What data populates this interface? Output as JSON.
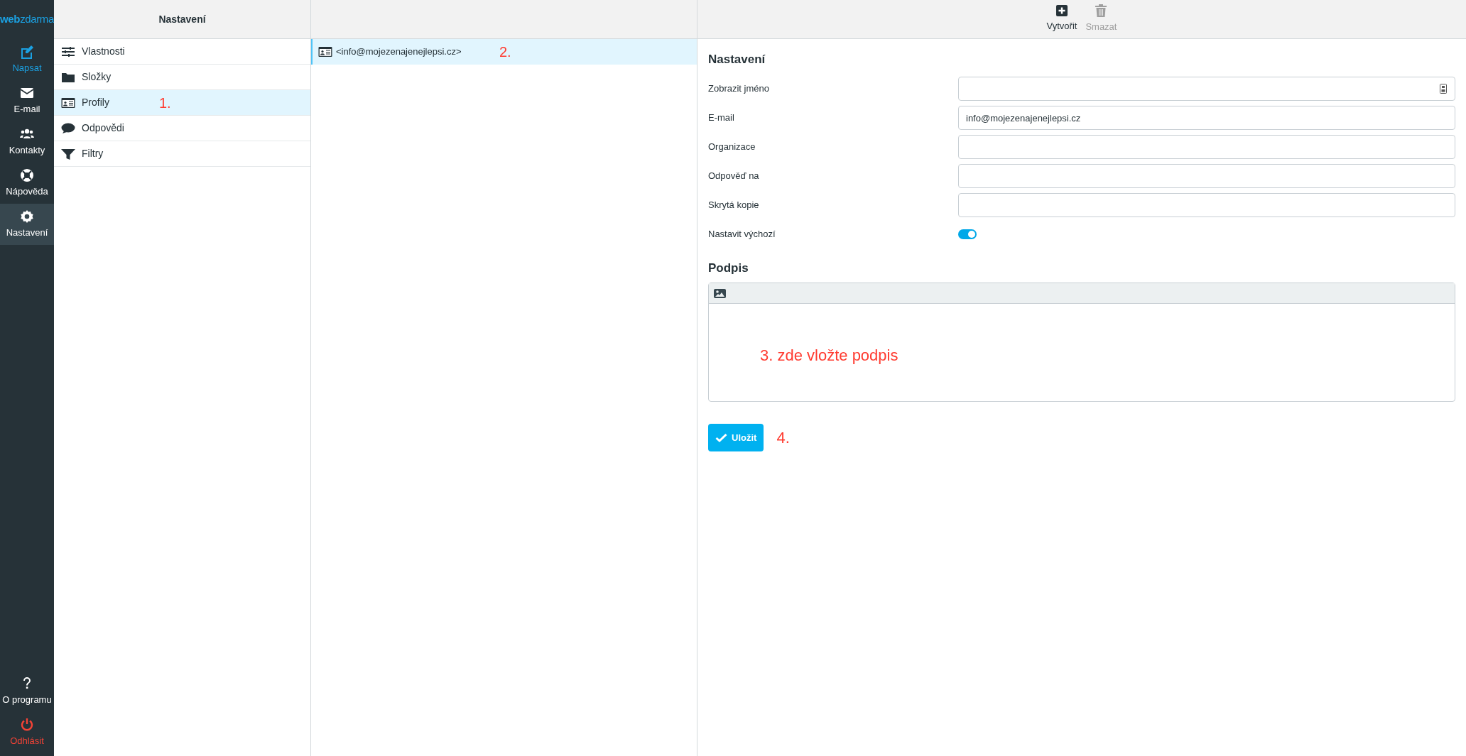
{
  "logo": {
    "part_1": "web",
    "part_2": "zdarma"
  },
  "nav": [
    {
      "kind": "compose",
      "label": "Napsat",
      "selected": false,
      "accent": true
    },
    {
      "kind": "mail",
      "label": "E-mail",
      "selected": false,
      "accent": false
    },
    {
      "kind": "contacts",
      "label": "Kontakty",
      "selected": false,
      "accent": false
    },
    {
      "kind": "help",
      "label": "Nápověda",
      "selected": false,
      "accent": false
    },
    {
      "kind": "settings",
      "label": "Nastavení",
      "selected": true,
      "accent": false
    }
  ],
  "nav_bottom": [
    {
      "kind": "about",
      "label": "O programu",
      "danger": false
    },
    {
      "kind": "logout",
      "label": "Odhlásit",
      "danger": true
    }
  ],
  "settings_panel": {
    "title": "Nastavení",
    "items": [
      {
        "kind": "sliders",
        "label": "Vlastnosti",
        "selected": false
      },
      {
        "kind": "folder",
        "label": "Složky",
        "selected": false
      },
      {
        "kind": "card",
        "label": "Profily",
        "selected": true,
        "note": "1."
      },
      {
        "kind": "speech",
        "label": "Odpovědi",
        "selected": false
      },
      {
        "kind": "filter",
        "label": "Filtry",
        "selected": false
      }
    ]
  },
  "identities": [
    {
      "label": "<info@mojezenajenejlepsi.cz>",
      "selected": true,
      "note": "2."
    }
  ],
  "toolbar": [
    {
      "kind": "create",
      "label": "Vytvořit",
      "disabled": false
    },
    {
      "kind": "delete",
      "label": "Smazat",
      "disabled": true
    }
  ],
  "form": {
    "section": "Nastavení",
    "fields": [
      {
        "kind": "text",
        "label": "Zobrazit jméno",
        "icon": true
      },
      {
        "kind": "text",
        "label": "E-mail",
        "value": "info@mojezenajenejlepsi.cz"
      },
      {
        "kind": "text",
        "label": "Organizace"
      },
      {
        "kind": "text",
        "label": "Odpověď na"
      },
      {
        "kind": "text",
        "label": "Skrytá kopie"
      },
      {
        "kind": "toggle",
        "label": "Nastavit výchozí",
        "on": true
      }
    ],
    "signature_title": "Podpis",
    "signature_note": "3. zde vložte podpis",
    "save": "Uložit",
    "save_note": "4."
  }
}
